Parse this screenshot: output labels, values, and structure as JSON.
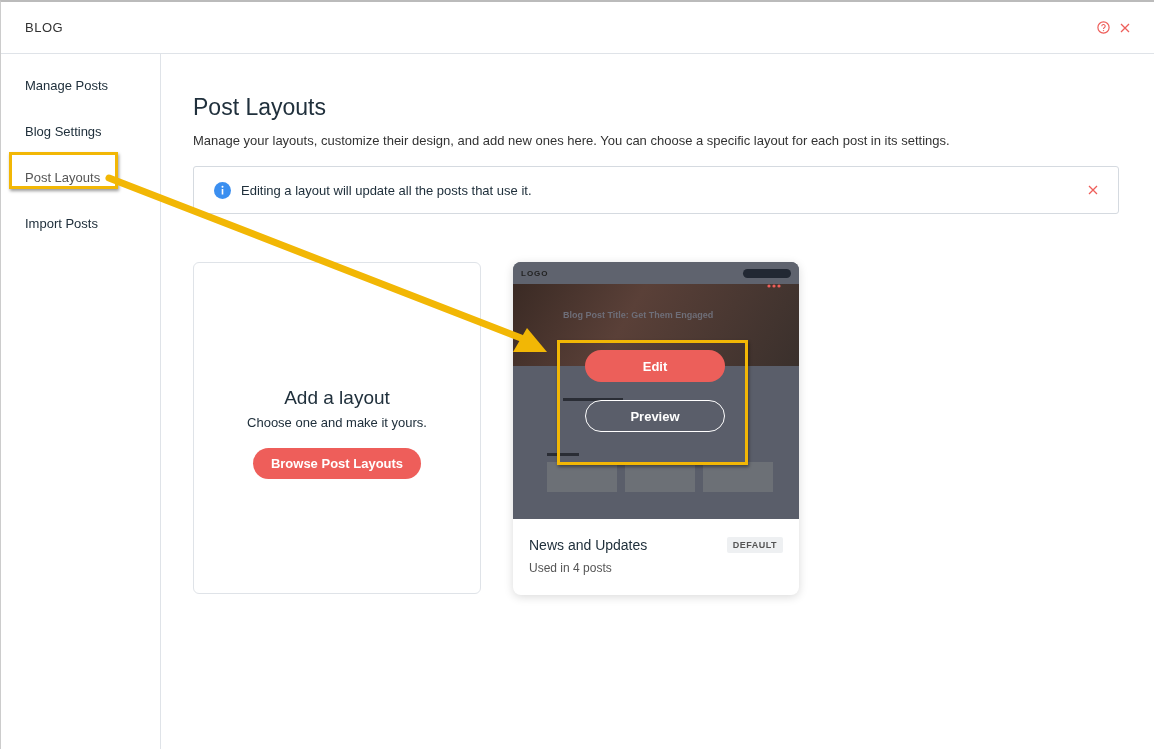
{
  "window": {
    "title": "BLOG"
  },
  "sidebar": {
    "items": [
      {
        "label": "Manage Posts",
        "selected": false
      },
      {
        "label": "Blog Settings",
        "selected": false
      },
      {
        "label": "Post Layouts",
        "selected": true
      },
      {
        "label": "Import Posts",
        "selected": false
      }
    ]
  },
  "page": {
    "title": "Post Layouts",
    "description": "Manage your layouts, customize their design, and add new ones here. You can choose a specific layout for each post in its settings."
  },
  "notice": {
    "text": "Editing a layout will update all the posts that use it."
  },
  "add_card": {
    "title": "Add a layout",
    "subtitle": "Choose one and make it yours.",
    "button": "Browse Post Layouts"
  },
  "layouts": [
    {
      "name": "News and Updates",
      "usage": "Used in 4 posts",
      "badge": "DEFAULT",
      "preview": {
        "logo": "LOGO",
        "post_title": "Blog Post Title: Get Them Engaged"
      },
      "actions": [
        "Edit",
        "Preview"
      ]
    }
  ]
}
